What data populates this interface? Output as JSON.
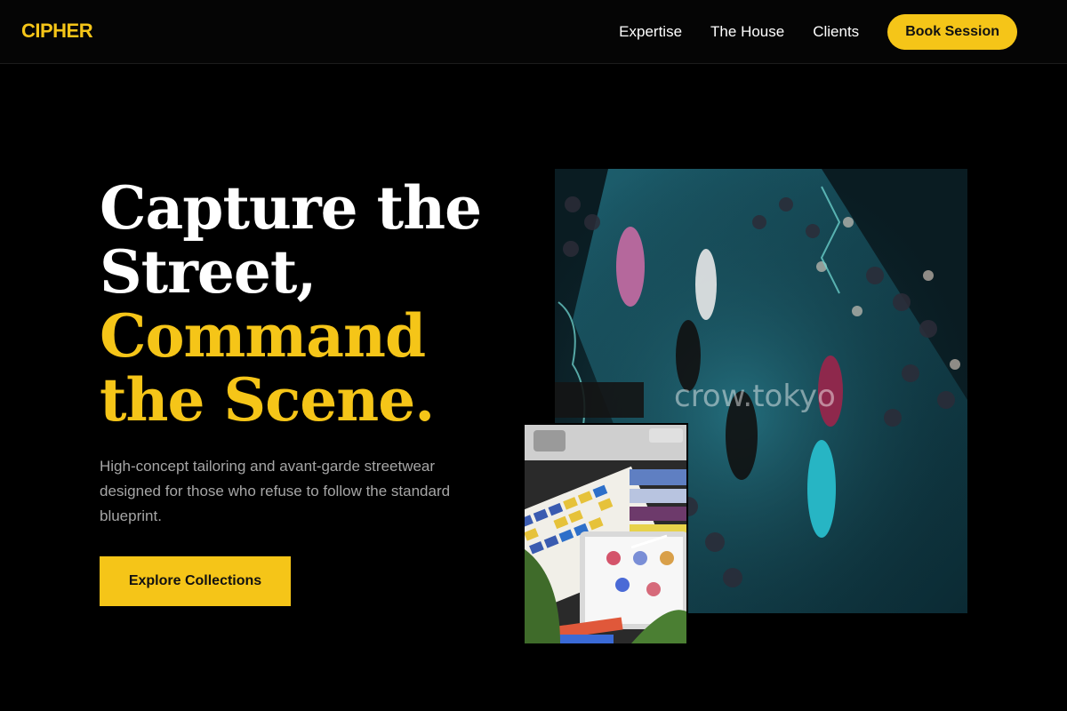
{
  "brand": {
    "name": "CIPHER",
    "accent_color": "#f5c518"
  },
  "nav": {
    "items": [
      {
        "label": "Expertise"
      },
      {
        "label": "The House"
      },
      {
        "label": "Clients"
      }
    ],
    "cta_label": "Book Session"
  },
  "hero": {
    "title_lines": [
      "Capture the",
      "Street,",
      "Command",
      "the Scene."
    ],
    "subtitle": "High-concept tailoring and avant-garde streetwear designed for those who refuse to follow the standard blueprint.",
    "cta_label": "Explore Collections"
  },
  "images": {
    "main_watermark": "crow.tokyo"
  }
}
